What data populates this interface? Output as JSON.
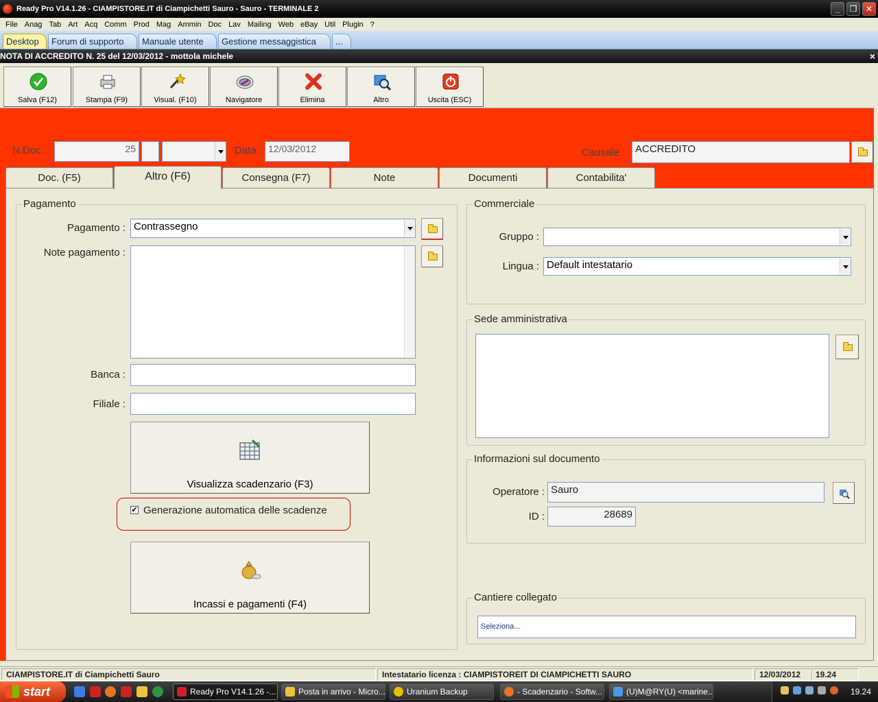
{
  "window": {
    "title": "Ready Pro V14.1.26 - CIAMPISTORE.IT di Ciampichetti Sauro - Sauro - TERMINALE 2",
    "min": "_",
    "max": "❐",
    "close": "✕"
  },
  "menu": [
    "File",
    "Anag",
    "Tab",
    "Art",
    "Acq",
    "Comm",
    "Prod",
    "Mag",
    "Ammin",
    "Doc",
    "Lav",
    "Mailing",
    "Web",
    "eBay",
    "Util",
    "Plugin",
    "?"
  ],
  "desktop_tabs": [
    "Desktop",
    "Forum di supporto",
    "Manuale utente",
    "Gestione messaggistica",
    "..."
  ],
  "doc_header": {
    "title": "NOTA DI ACCREDITO N. 25  del 12/03/2012 - mottola michele",
    "close": "×"
  },
  "toolbar": {
    "save": "Salva (F12)",
    "print": "Stampa (F9)",
    "view": "Visual. (F10)",
    "navigator": "Navigatore",
    "delete": "Elimina",
    "other": "Altro",
    "exit": "Uscita (ESC)"
  },
  "header": {
    "ndoc_label": "N.Doc. :",
    "ndoc_value": "25",
    "data_label": "Data :",
    "data_value": "12/03/2012",
    "causale_label": "Causale :",
    "causale_value": "ACCREDITO"
  },
  "tabs": [
    "Doc. (F5)",
    "Altro (F6)",
    "Consegna (F7)",
    "Note",
    "Documenti",
    "Contabilita'"
  ],
  "pagamento": {
    "group_title": "Pagamento",
    "pagamento_label": "Pagamento :",
    "pagamento_value": "Contrassegno",
    "note_label": "Note pagamento :",
    "banca_label": "Banca :",
    "filiale_label": "Filiale :",
    "scadenzario_button": "Visualizza scadenzario (F3)",
    "auto_gen_label": "Generazione automatica delle scadenze",
    "incassi_button": "Incassi e pagamenti (F4)"
  },
  "commerciale": {
    "group_title": "Commerciale",
    "gruppo_label": "Gruppo :",
    "gruppo_value": "",
    "lingua_label": "Lingua :",
    "lingua_value": "Default intestatario"
  },
  "sede": {
    "group_title": "Sede amministrativa"
  },
  "info": {
    "group_title": "Informazioni sul documento",
    "operatore_label": "Operatore :",
    "operatore_value": "Sauro",
    "id_label": "ID :",
    "id_value": "28689"
  },
  "cantiere": {
    "group_title": "Cantiere collegato",
    "placeholder": "Seleziona..."
  },
  "status": {
    "company": "CIAMPISTORE.IT di Ciampichetti Sauro",
    "license": "Intestatario licenza : CIAMPISTOREIT DI CIAMPICHETTI SAURO",
    "date": "12/03/2012",
    "time": "19.24"
  },
  "taskbar": {
    "start": "start",
    "tasks": [
      "Ready Pro V14.1.26 -...",
      "Posta in arrivo - Micro...",
      "Uranium Backup",
      "- Scadenzario - Softw...",
      "(U)M@RY(U) <marine..."
    ],
    "clock": "19.24"
  }
}
